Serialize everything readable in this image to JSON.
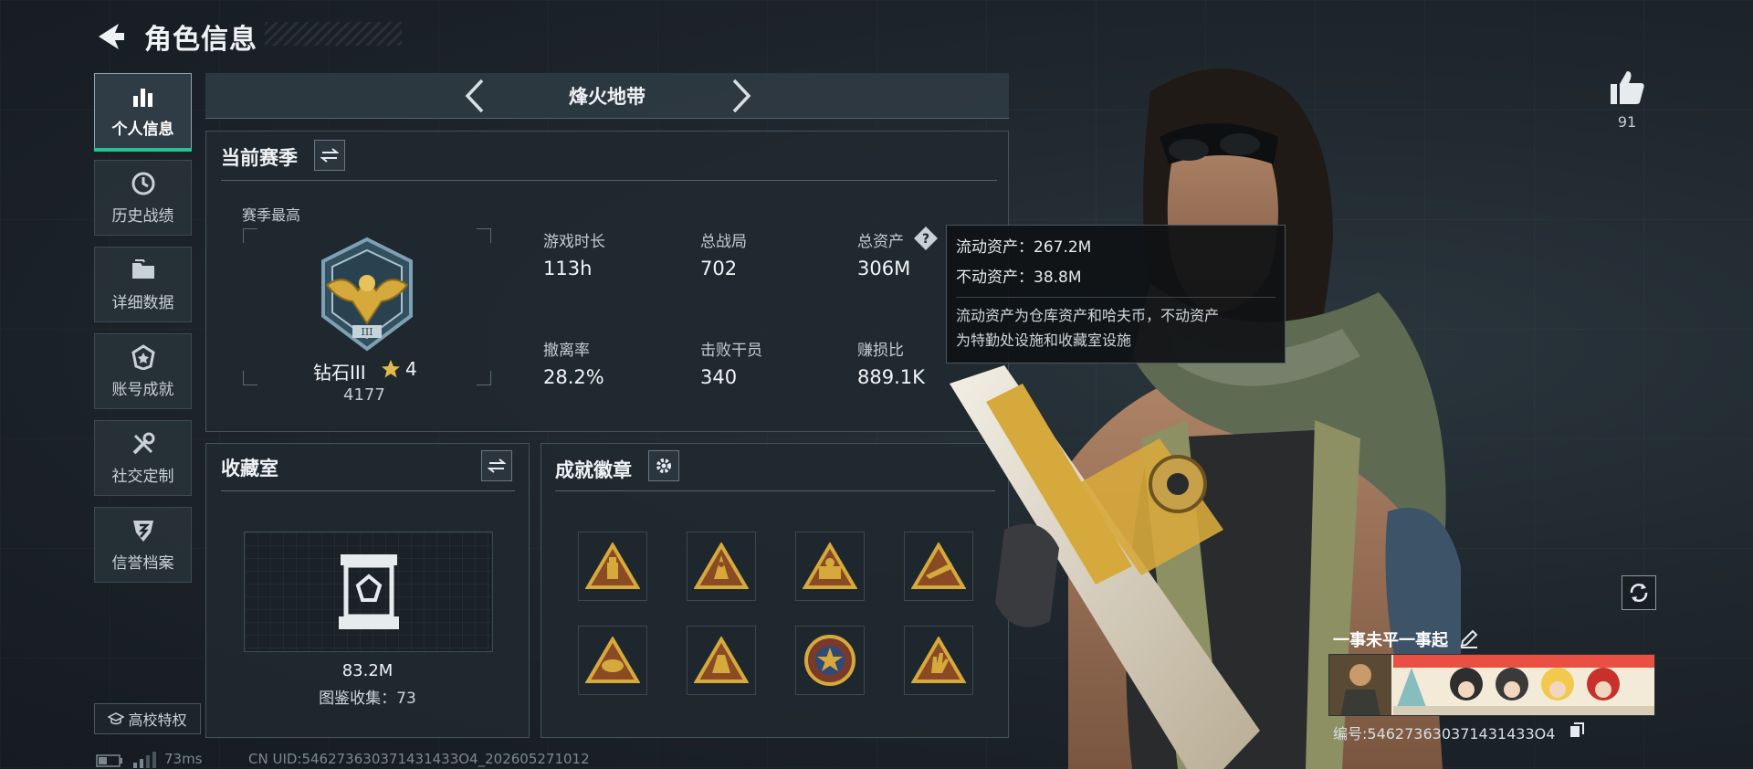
{
  "header": {
    "title": "角色信息"
  },
  "nav": {
    "items": [
      {
        "label": "个人信息",
        "icon": "bar-chart-icon",
        "active": true
      },
      {
        "label": "历史战绩",
        "icon": "history-icon",
        "active": false
      },
      {
        "label": "详细数据",
        "icon": "folder-icon",
        "active": false
      },
      {
        "label": "账号成就",
        "icon": "achievement-icon",
        "active": false
      },
      {
        "label": "社交定制",
        "icon": "tools-icon",
        "active": false
      },
      {
        "label": "信誉档案",
        "icon": "shield-icon",
        "active": false
      }
    ],
    "campus_button": "高校特权"
  },
  "mode": {
    "title": "烽火地带"
  },
  "season": {
    "title": "当前赛季",
    "best_label": "赛季最高",
    "rank_name": "钻石III",
    "rank_stars": "4",
    "rank_score": "4177",
    "stats": [
      {
        "label": "游戏时长",
        "value": "113h"
      },
      {
        "label": "总战局",
        "value": "702"
      },
      {
        "label": "总资产",
        "value": "306M"
      },
      {
        "label": "撤离率",
        "value": "28.2%"
      },
      {
        "label": "击败干员",
        "value": "340"
      },
      {
        "label": "赚损比",
        "value": "889.1K"
      }
    ]
  },
  "tooltip": {
    "liquid": "流动资产：267.2M",
    "fixed": "不动资产：38.8M",
    "desc1": "流动资产为仓库资产和哈夫币，不动资产",
    "desc2": "为特勤处设施和收藏室设施"
  },
  "collection": {
    "title": "收藏室",
    "value": "83.2M",
    "catalog": "图鉴收集：73"
  },
  "badges": {
    "title": "成就徽章",
    "items": [
      "badge-1",
      "badge-2",
      "badge-3",
      "badge-4",
      "badge-5",
      "badge-6",
      "badge-7",
      "badge-8"
    ]
  },
  "profile": {
    "likes": "91",
    "name": "一事未平一事起",
    "id": "编号:546273630371431433O4"
  },
  "status": {
    "ping": "73ms",
    "uid": "CN UID:546273630371431433O4_202605271012"
  },
  "colors": {
    "accent": "#23c48f",
    "gold": "#d6a93c",
    "panel": "#20292f"
  }
}
